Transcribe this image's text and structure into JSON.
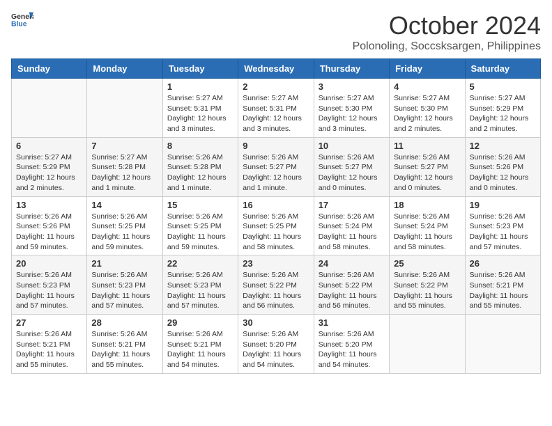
{
  "header": {
    "logo_general": "General",
    "logo_blue": "Blue",
    "month_title": "October 2024",
    "location": "Polonoling, Soccsksargen, Philippines"
  },
  "weekdays": [
    "Sunday",
    "Monday",
    "Tuesday",
    "Wednesday",
    "Thursday",
    "Friday",
    "Saturday"
  ],
  "weeks": [
    [
      {
        "day": "",
        "info": ""
      },
      {
        "day": "",
        "info": ""
      },
      {
        "day": "1",
        "info": "Sunrise: 5:27 AM\nSunset: 5:31 PM\nDaylight: 12 hours and 3 minutes."
      },
      {
        "day": "2",
        "info": "Sunrise: 5:27 AM\nSunset: 5:31 PM\nDaylight: 12 hours and 3 minutes."
      },
      {
        "day": "3",
        "info": "Sunrise: 5:27 AM\nSunset: 5:30 PM\nDaylight: 12 hours and 3 minutes."
      },
      {
        "day": "4",
        "info": "Sunrise: 5:27 AM\nSunset: 5:30 PM\nDaylight: 12 hours and 2 minutes."
      },
      {
        "day": "5",
        "info": "Sunrise: 5:27 AM\nSunset: 5:29 PM\nDaylight: 12 hours and 2 minutes."
      }
    ],
    [
      {
        "day": "6",
        "info": "Sunrise: 5:27 AM\nSunset: 5:29 PM\nDaylight: 12 hours and 2 minutes."
      },
      {
        "day": "7",
        "info": "Sunrise: 5:27 AM\nSunset: 5:28 PM\nDaylight: 12 hours and 1 minute."
      },
      {
        "day": "8",
        "info": "Sunrise: 5:26 AM\nSunset: 5:28 PM\nDaylight: 12 hours and 1 minute."
      },
      {
        "day": "9",
        "info": "Sunrise: 5:26 AM\nSunset: 5:27 PM\nDaylight: 12 hours and 1 minute."
      },
      {
        "day": "10",
        "info": "Sunrise: 5:26 AM\nSunset: 5:27 PM\nDaylight: 12 hours and 0 minutes."
      },
      {
        "day": "11",
        "info": "Sunrise: 5:26 AM\nSunset: 5:27 PM\nDaylight: 12 hours and 0 minutes."
      },
      {
        "day": "12",
        "info": "Sunrise: 5:26 AM\nSunset: 5:26 PM\nDaylight: 12 hours and 0 minutes."
      }
    ],
    [
      {
        "day": "13",
        "info": "Sunrise: 5:26 AM\nSunset: 5:26 PM\nDaylight: 11 hours and 59 minutes."
      },
      {
        "day": "14",
        "info": "Sunrise: 5:26 AM\nSunset: 5:25 PM\nDaylight: 11 hours and 59 minutes."
      },
      {
        "day": "15",
        "info": "Sunrise: 5:26 AM\nSunset: 5:25 PM\nDaylight: 11 hours and 59 minutes."
      },
      {
        "day": "16",
        "info": "Sunrise: 5:26 AM\nSunset: 5:25 PM\nDaylight: 11 hours and 58 minutes."
      },
      {
        "day": "17",
        "info": "Sunrise: 5:26 AM\nSunset: 5:24 PM\nDaylight: 11 hours and 58 minutes."
      },
      {
        "day": "18",
        "info": "Sunrise: 5:26 AM\nSunset: 5:24 PM\nDaylight: 11 hours and 58 minutes."
      },
      {
        "day": "19",
        "info": "Sunrise: 5:26 AM\nSunset: 5:23 PM\nDaylight: 11 hours and 57 minutes."
      }
    ],
    [
      {
        "day": "20",
        "info": "Sunrise: 5:26 AM\nSunset: 5:23 PM\nDaylight: 11 hours and 57 minutes."
      },
      {
        "day": "21",
        "info": "Sunrise: 5:26 AM\nSunset: 5:23 PM\nDaylight: 11 hours and 57 minutes."
      },
      {
        "day": "22",
        "info": "Sunrise: 5:26 AM\nSunset: 5:23 PM\nDaylight: 11 hours and 57 minutes."
      },
      {
        "day": "23",
        "info": "Sunrise: 5:26 AM\nSunset: 5:22 PM\nDaylight: 11 hours and 56 minutes."
      },
      {
        "day": "24",
        "info": "Sunrise: 5:26 AM\nSunset: 5:22 PM\nDaylight: 11 hours and 56 minutes."
      },
      {
        "day": "25",
        "info": "Sunrise: 5:26 AM\nSunset: 5:22 PM\nDaylight: 11 hours and 55 minutes."
      },
      {
        "day": "26",
        "info": "Sunrise: 5:26 AM\nSunset: 5:21 PM\nDaylight: 11 hours and 55 minutes."
      }
    ],
    [
      {
        "day": "27",
        "info": "Sunrise: 5:26 AM\nSunset: 5:21 PM\nDaylight: 11 hours and 55 minutes."
      },
      {
        "day": "28",
        "info": "Sunrise: 5:26 AM\nSunset: 5:21 PM\nDaylight: 11 hours and 55 minutes."
      },
      {
        "day": "29",
        "info": "Sunrise: 5:26 AM\nSunset: 5:21 PM\nDaylight: 11 hours and 54 minutes."
      },
      {
        "day": "30",
        "info": "Sunrise: 5:26 AM\nSunset: 5:20 PM\nDaylight: 11 hours and 54 minutes."
      },
      {
        "day": "31",
        "info": "Sunrise: 5:26 AM\nSunset: 5:20 PM\nDaylight: 11 hours and 54 minutes."
      },
      {
        "day": "",
        "info": ""
      },
      {
        "day": "",
        "info": ""
      }
    ]
  ]
}
